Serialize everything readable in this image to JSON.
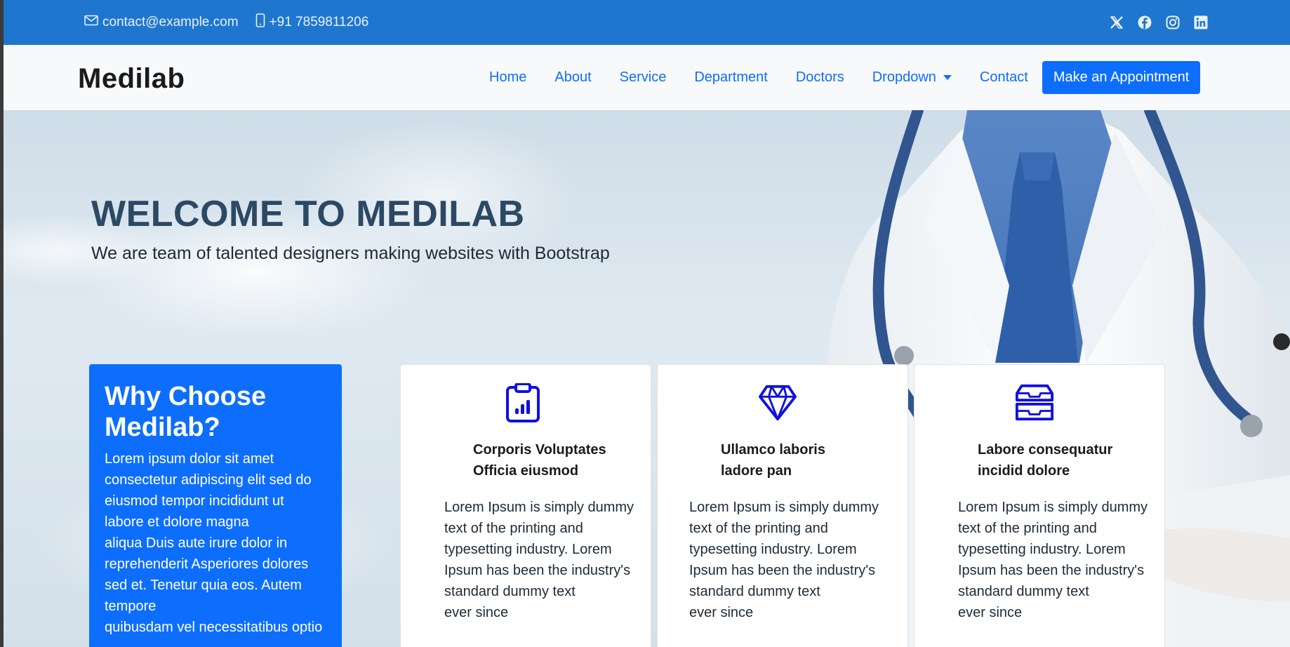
{
  "topbar": {
    "email": "contact@example.com",
    "phone": "+91 7859811206",
    "social": [
      "x-icon",
      "facebook-icon",
      "instagram-icon",
      "linkedin-icon"
    ]
  },
  "navbar": {
    "brand": "Medilab",
    "links": [
      "Home",
      "About",
      "Service",
      "Department",
      "Doctors",
      "Dropdown",
      "Contact"
    ],
    "cta": "Make an Appointment"
  },
  "hero": {
    "title": "WELCOME TO MEDILAB",
    "subtitle": "We are team of talented designers making websites with Bootstrap"
  },
  "why": {
    "title_line1": "Why Choose",
    "title_line2": "Medilab?",
    "lines": [
      "Lorem ipsum dolor sit amet",
      "consectetur adipiscing elit sed do",
      "eiusmod tempor incididunt ut",
      "labore et dolore magna",
      "aliqua Duis aute irure dolor in",
      "reprehenderit Asperiores dolores",
      "sed et. Tenetur quia eos. Autem",
      "tempore",
      "quibusdam vel necessitatibus optio"
    ]
  },
  "cards": [
    {
      "icon": "clipboard-data-icon",
      "title_line1": "Corporis Voluptates",
      "title_line2": "Officia eiusmod",
      "text": [
        "Lorem Ipsum is simply dummy",
        "text of the printing and",
        "typesetting industry. Lorem",
        "Ipsum has been the industry's",
        "standard dummy text",
        "ever since"
      ]
    },
    {
      "icon": "gem-icon",
      "title_line1": "Ullamco laboris",
      "title_line2": "ladore pan",
      "text": [
        "Lorem Ipsum is simply dummy",
        "text of the printing and",
        "typesetting industry. Lorem",
        "Ipsum has been the industry's",
        "standard dummy text",
        "ever since"
      ]
    },
    {
      "icon": "inboxes-icon",
      "title_line1": "Labore consequatur",
      "title_line2": "incidid dolore",
      "text": [
        "Lorem Ipsum is simply dummy",
        "text of the printing and",
        "typesetting industry. Lorem",
        "Ipsum has been the industry's",
        "standard dummy text",
        "ever since"
      ]
    }
  ],
  "colors": {
    "topbar": "#1e76cf",
    "primary": "#0d6efd",
    "hero_title": "#2c4964",
    "icon": "#1010e0"
  }
}
